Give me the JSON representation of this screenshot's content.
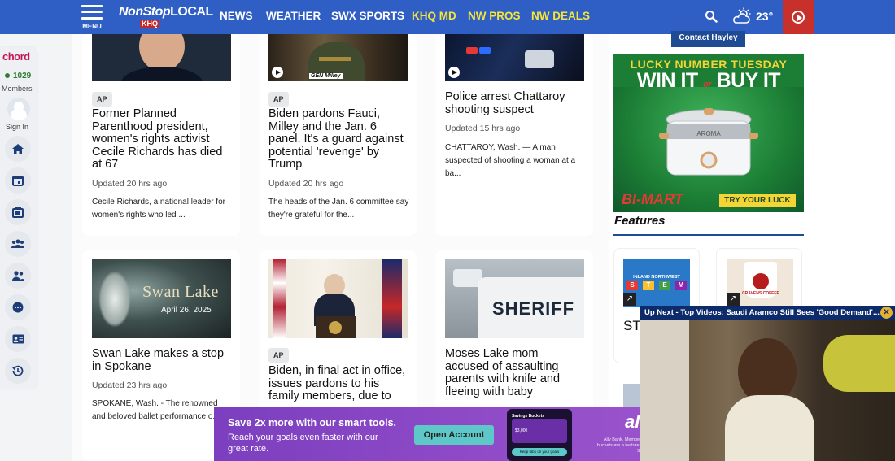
{
  "header": {
    "menu_label": "MENU",
    "logo_main": "NonStop",
    "logo_bold": "LOCAL",
    "logo_sub": "KHQ",
    "nav": [
      {
        "label": "NEWS",
        "color": "#ffffff"
      },
      {
        "label": "WEATHER",
        "color": "#ffffff"
      },
      {
        "label": "SWX SPORTS",
        "color": "#ffffff"
      },
      {
        "label": "KHQ MD",
        "color": "#f5e53b"
      },
      {
        "label": "NW PROS",
        "color": "#f5e53b"
      },
      {
        "label": "NW DEALS",
        "color": "#f5e53b"
      }
    ],
    "temperature": "23°",
    "search_icon": "search-icon",
    "weather_icon": "partly-cloudy-icon",
    "play_icon": "play-circle-icon"
  },
  "rail": {
    "brand": "chord",
    "members_count": "1029",
    "members_label": "Members",
    "sign_in": "Sign In",
    "icons": [
      "home-icon",
      "calendar-icon",
      "news-icon",
      "group-icon",
      "people-icon",
      "chat-icon",
      "contact-card-icon",
      "history-icon"
    ]
  },
  "articles": [
    {
      "badge": "AP",
      "title": "Former Planned Parenthood president, women's rights activist Cecile Richards has died at 67",
      "updated": "Updated 20 hrs ago",
      "summary": "Cecile Richards, a national leader for women's rights who led ..."
    },
    {
      "badge": "AP",
      "thumb_caption": "GEN Milley",
      "title": "Biden pardons Fauci, Milley and the Jan. 6 panel. It's a guard against potential 'revenge' by Trump",
      "updated": "Updated 20 hrs ago",
      "summary": "The heads of the Jan. 6 committee say they're grateful for the..."
    },
    {
      "title": "Police arrest Chattaroy shooting suspect",
      "updated": "Updated 15 hrs ago",
      "summary": "CHATTAROY, Wash. — A man suspected of shooting a woman at a ba..."
    },
    {
      "thumb_title": "Swan Lake",
      "thumb_date": "April 26, 2025",
      "title": "Swan Lake makes a stop in Spokane",
      "updated": "Updated 23 hrs ago",
      "summary": "SPOKANE, Wash. - The renowned and beloved ballet performance o..."
    },
    {
      "badge": "AP",
      "title": "Biden, in final act in office, issues pardons to his family members, due to",
      "updated": "",
      "summary": ""
    },
    {
      "thumb_text": "SHERIFF",
      "title": "Moses Lake mom accused of assaulting parents with knife and fleeing with baby",
      "updated": "",
      "summary": ""
    }
  ],
  "sidebar": {
    "contact": "Contact Hayley",
    "ad_line1": "LUCKY NUMBER TUESDAY",
    "ad_line2_a": "WIN IT",
    "ad_or": "or",
    "ad_line2_b": "BUY IT",
    "ad_brand": "BI-MART",
    "ad_cta": "TRY YOUR LUCK",
    "ad_product": "AROMA",
    "features_title": "Features",
    "feature_tiles": [
      {
        "label_top": "INLAND NORTHWEST",
        "letters": [
          "S",
          "T",
          "E",
          "M"
        ]
      },
      {
        "label": "CRAVENS COFFEE"
      }
    ],
    "feature_text_partial": "ST"
  },
  "popup": {
    "bar_text": "Up Next - Top Videos: Saudi Aramco Still Sees 'Good Demand'...",
    "close": "✕"
  },
  "bottom_ad": {
    "headline": "Save 2x more with our smart tools.",
    "body": "Reach your goals even faster with our great rate.",
    "cta": "Open Account",
    "brand": "ally",
    "phone_label": "Savings Buckets",
    "phone_amount": "$3,000",
    "phone_caption": "Keep tabs on your goals",
    "fine": "Ally Bank, Member FDIC. Savings buckets are a feature of the Ally Bank Savings Account.",
    "close": "✕"
  }
}
